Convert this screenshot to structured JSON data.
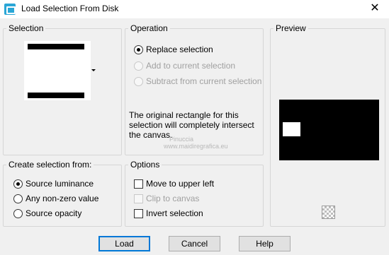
{
  "window": {
    "title": "Load Selection From Disk",
    "close_glyph": "✕"
  },
  "selection": {
    "legend": "Selection"
  },
  "operation": {
    "legend": "Operation",
    "options": [
      {
        "label": "Replace selection",
        "selected": true,
        "enabled": true
      },
      {
        "label": "Add to current selection",
        "selected": false,
        "enabled": false
      },
      {
        "label": "Subtract from current selection",
        "selected": false,
        "enabled": false
      }
    ],
    "description_line1": "The original rectangle for this",
    "description_line2": "selection will completely intersect",
    "description_line3": "the canvas."
  },
  "preview": {
    "legend": "Preview",
    "zoom_icon": "checkerboard-icon"
  },
  "create_from": {
    "legend": "Create selection from:",
    "options": [
      {
        "label": "Source luminance",
        "selected": true
      },
      {
        "label": "Any non-zero value",
        "selected": false
      },
      {
        "label": "Source opacity",
        "selected": false
      }
    ]
  },
  "options": {
    "legend": "Options",
    "checks": [
      {
        "label": "Move to upper left",
        "checked": false,
        "enabled": true
      },
      {
        "label": "Clip to canvas",
        "checked": false,
        "enabled": false
      },
      {
        "label": "Invert selection",
        "checked": false,
        "enabled": true
      }
    ]
  },
  "buttons": {
    "load": "Load",
    "cancel": "Cancel",
    "help": "Help"
  },
  "watermark": {
    "name": "Pinuccia",
    "url": "www.maidiregrafica.eu"
  }
}
